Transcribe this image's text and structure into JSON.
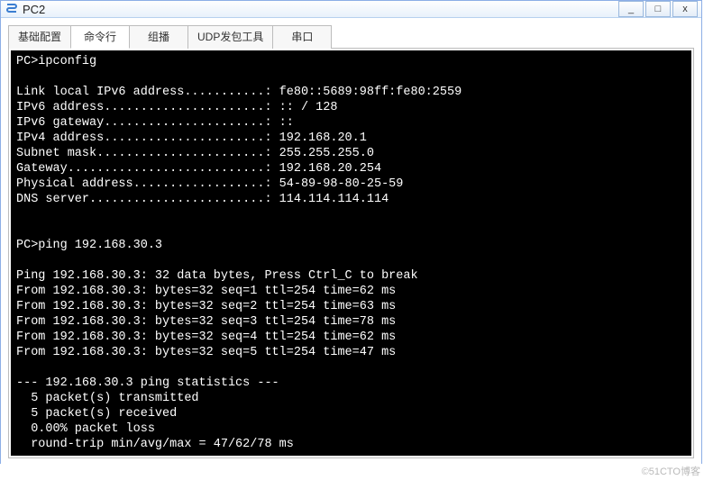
{
  "window": {
    "title": "PC2",
    "buttons": {
      "min": "_",
      "max": "□",
      "close": "x"
    }
  },
  "tabs": [
    {
      "label": "基础配置"
    },
    {
      "label": "命令行"
    },
    {
      "label": "组播"
    },
    {
      "label": "UDP发包工具"
    },
    {
      "label": "串口"
    }
  ],
  "terminal": {
    "lines": [
      "PC>ipconfig",
      "",
      "Link local IPv6 address...........: fe80::5689:98ff:fe80:2559",
      "IPv6 address......................: :: / 128",
      "IPv6 gateway......................: ::",
      "IPv4 address......................: 192.168.20.1",
      "Subnet mask.......................: 255.255.255.0",
      "Gateway...........................: 192.168.20.254",
      "Physical address..................: 54-89-98-80-25-59",
      "DNS server........................: 114.114.114.114",
      "",
      "",
      "PC>ping 192.168.30.3",
      "",
      "Ping 192.168.30.3: 32 data bytes, Press Ctrl_C to break",
      "From 192.168.30.3: bytes=32 seq=1 ttl=254 time=62 ms",
      "From 192.168.30.3: bytes=32 seq=2 ttl=254 time=63 ms",
      "From 192.168.30.3: bytes=32 seq=3 ttl=254 time=78 ms",
      "From 192.168.30.3: bytes=32 seq=4 ttl=254 time=62 ms",
      "From 192.168.30.3: bytes=32 seq=5 ttl=254 time=47 ms",
      "",
      "--- 192.168.30.3 ping statistics ---",
      "  5 packet(s) transmitted",
      "  5 packet(s) received",
      "  0.00% packet loss",
      "  round-trip min/avg/max = 47/62/78 ms"
    ]
  },
  "watermark": "©51CTO博客"
}
